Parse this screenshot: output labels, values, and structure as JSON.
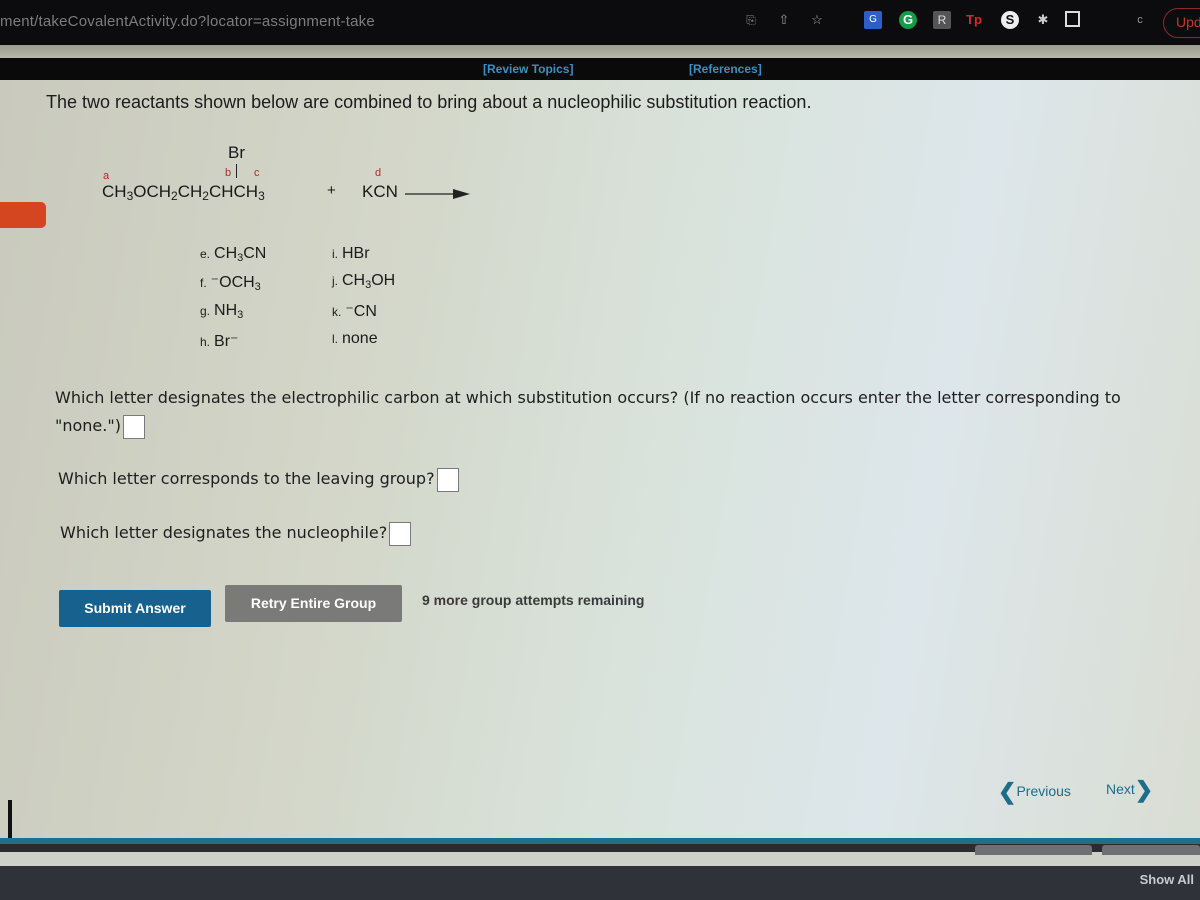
{
  "browser": {
    "url": "ment/takeCovalentActivity.do?locator=assignment-take",
    "icons": [
      "translate-icon",
      "share-icon",
      "bookmark-star-icon",
      "google-translate-extension-icon",
      "grammarly-extension-icon",
      "extension-r-icon",
      "tp-extension-icon",
      "s-extension-icon",
      "extensions-puzzle-icon",
      "sidebar-icon"
    ],
    "profile_letter": "c",
    "update_label": "Upd"
  },
  "header_links": {
    "review_topics": "[Review Topics]",
    "references": "[References]"
  },
  "intro": "The two reactants shown below are combined to bring about a nucleophilic substitution reaction.",
  "reaction": {
    "substituent": "Br",
    "labels": {
      "a": "a",
      "b": "b",
      "c": "c",
      "d": "d"
    },
    "reactant1_parts": [
      "CH",
      "3",
      "OCH",
      "2",
      "CH",
      "2",
      "CHCH",
      "3"
    ],
    "plus": "+",
    "reactant2": "KCN"
  },
  "options": [
    {
      "letter": "e.",
      "formula": "CH",
      "sub": "3",
      "rest": "CN"
    },
    {
      "letter": "f.",
      "formula": "⁻OCH",
      "sub": "3",
      "rest": ""
    },
    {
      "letter": "g.",
      "formula": "NH",
      "sub": "3",
      "rest": ""
    },
    {
      "letter": "h.",
      "formula": "Br⁻",
      "sub": "",
      "rest": ""
    },
    {
      "letter": "i.",
      "formula": "HBr",
      "sub": "",
      "rest": ""
    },
    {
      "letter": "j.",
      "formula": "CH",
      "sub": "3",
      "rest": "OH"
    },
    {
      "letter": "k.",
      "formula": "⁻CN",
      "sub": "",
      "rest": ""
    },
    {
      "letter": "l.",
      "formula": "none",
      "sub": "",
      "rest": ""
    }
  ],
  "questions": {
    "q1": "Which letter designates the electrophilic carbon at which substitution occurs? (If no reaction occurs enter the letter corresponding to \"none.\")",
    "q1_value": "",
    "q2": "Which letter corresponds to the leaving group?",
    "q2_value": "",
    "q3": "Which letter designates the nucleophile?",
    "q3_value": ""
  },
  "buttons": {
    "submit": "Submit Answer",
    "retry": "Retry Entire Group",
    "attempts": "9 more group attempts remaining"
  },
  "nav": {
    "previous": "Previous",
    "next": "Next"
  },
  "footer": {
    "show_all": "Show All"
  }
}
